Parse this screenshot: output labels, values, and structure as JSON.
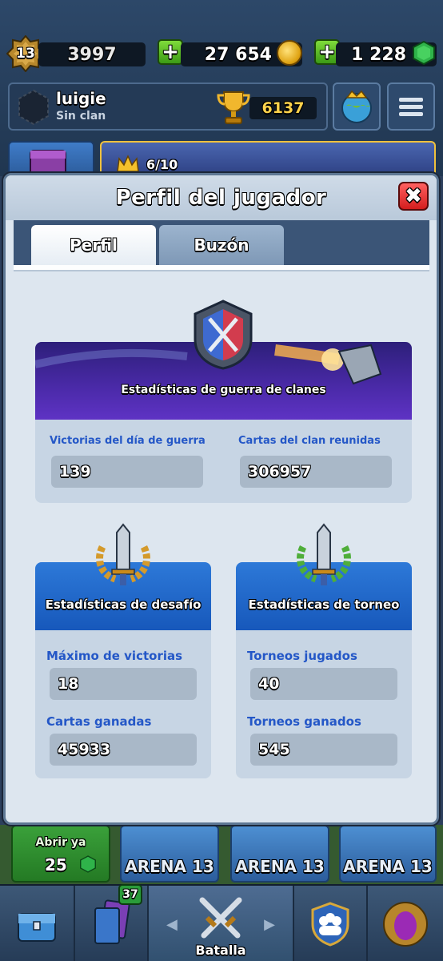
{
  "header": {
    "level": "13",
    "xp": "3997",
    "gold": "27 654",
    "gems": "1 228",
    "player_name": "luigie",
    "clan": "Sin clan",
    "trophies": "6137",
    "banner_progress": "6/10"
  },
  "modal": {
    "title": "Perfil del jugador",
    "tabs": [
      {
        "label": "Perfil",
        "active": true
      },
      {
        "label": "Buzón",
        "active": false
      }
    ],
    "clan_war": {
      "title": "Estadísticas de guerra de clanes",
      "stats": [
        {
          "label": "Victorias del día de guerra",
          "value": "139"
        },
        {
          "label": "Cartas del clan reunidas",
          "value": "306957"
        }
      ]
    },
    "challenge": {
      "title": "Estadísticas de desafío",
      "stats": [
        {
          "label": "Máximo de victorias",
          "value": "18"
        },
        {
          "label": "Cartas ganadas",
          "value": "45933"
        }
      ]
    },
    "tournament": {
      "title": "Estadísticas de torneo",
      "stats": [
        {
          "label": "Torneos jugados",
          "value": "40"
        },
        {
          "label": "Torneos ganados",
          "value": "545"
        }
      ]
    }
  },
  "chests": [
    {
      "label": "Abrir ya",
      "count": "25"
    },
    {
      "label": "ARENA 13"
    },
    {
      "label": "ARENA 13"
    },
    {
      "label": "ARENA 13"
    }
  ],
  "nav": {
    "cards_badge": "37",
    "battle_label": "Batalla"
  },
  "colors": {
    "stat_label": "#2457c7",
    "war_banner": "#4b2aa9",
    "stat_banner": "#1758bb",
    "close_button": "#d41e1e",
    "gem": "#2fb34a"
  }
}
